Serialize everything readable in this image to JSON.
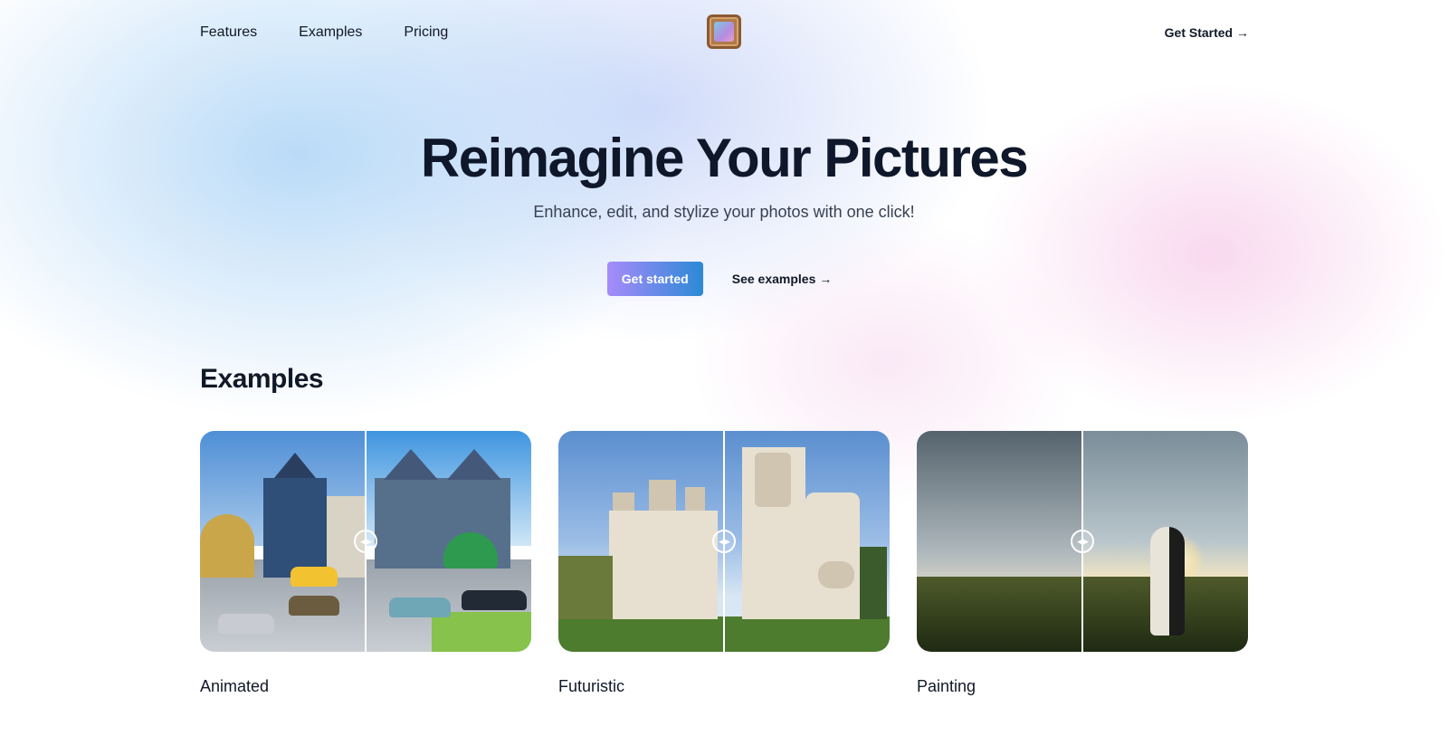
{
  "nav": {
    "links": [
      "Features",
      "Examples",
      "Pricing"
    ],
    "cta": "Get Started →"
  },
  "hero": {
    "title": "Reimagine Your Pictures",
    "subtitle": "Enhance, edit, and stylize your photos with one click!",
    "primary_button": "Get started",
    "secondary_button": "See examples →"
  },
  "examples": {
    "title": "Examples",
    "cards": [
      {
        "label": "Animated",
        "handle_icon": "arrows-left-right-icon"
      },
      {
        "label": "Futuristic",
        "handle_icon": "arrows-left-right-icon"
      },
      {
        "label": "Painting",
        "handle_icon": "arrows-left-right-icon"
      }
    ]
  },
  "colors": {
    "button_gradient_start": "#a78bfa",
    "button_gradient_end": "#2b8ad6",
    "text": "#111827"
  }
}
